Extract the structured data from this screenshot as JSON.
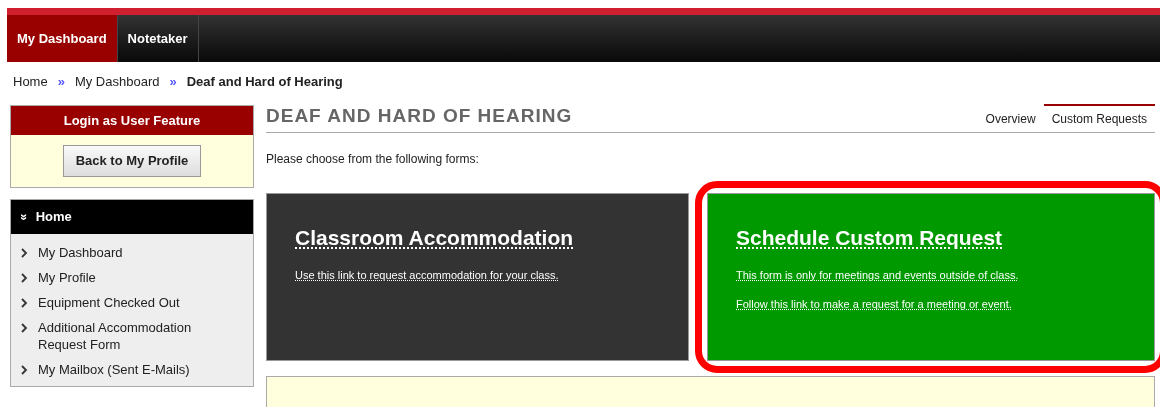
{
  "nav_tabs": [
    {
      "label": "My Dashboard",
      "selected": true
    },
    {
      "label": "Notetaker",
      "selected": false
    }
  ],
  "breadcrumb": [
    {
      "label": "Home",
      "current": false
    },
    {
      "label": "My Dashboard",
      "current": false
    },
    {
      "label": "Deaf and Hard of Hearing",
      "current": true
    }
  ],
  "breadcrumb_separator": "»",
  "login_panel": {
    "title": "Login as User Feature",
    "button": "Back to My Profile"
  },
  "sidebar": {
    "heading_icon": "»",
    "heading": "Home",
    "items": [
      "My Dashboard",
      "My Profile",
      "Equipment Checked Out",
      "Additional Accommodation Request Form",
      "My Mailbox (Sent E-Mails)"
    ]
  },
  "page_title": "DEAF AND HARD OF HEARING",
  "sub_tabs": [
    {
      "label": "Overview",
      "selected": false
    },
    {
      "label": "Custom Requests",
      "selected": true
    }
  ],
  "intro": "Please choose from the following forms:",
  "form_cards": [
    {
      "title": "Classroom Accommodation",
      "color": "#333333",
      "highlighted": false,
      "links": [
        "Use this link to request accommodation for your class."
      ]
    },
    {
      "title": "Schedule Custom Request",
      "color": "#009900",
      "highlighted": true,
      "links": [
        "This form is only for meetings and events outside of class.",
        "Follow this link to make a request for a meeting or event."
      ]
    }
  ]
}
